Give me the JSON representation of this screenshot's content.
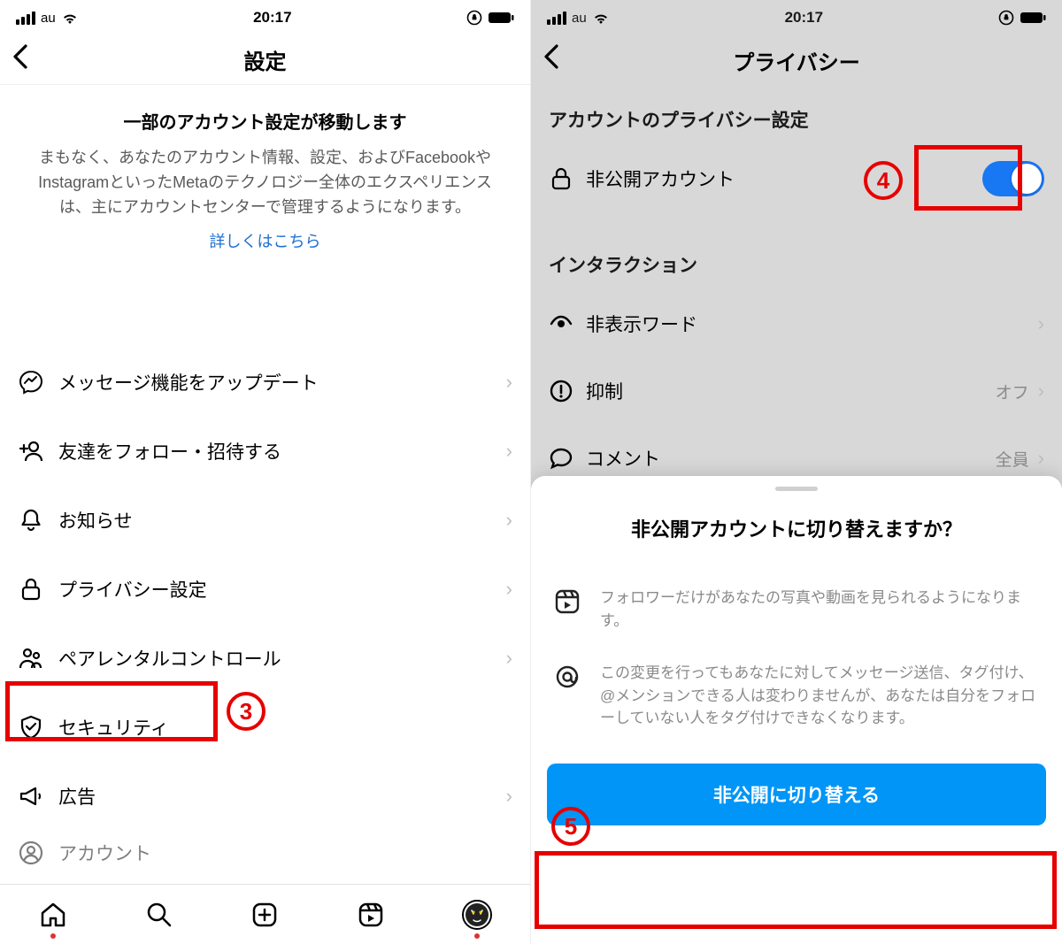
{
  "status": {
    "carrier": "au",
    "time": "20:17"
  },
  "left": {
    "title": "設定",
    "notice": {
      "title": "一部のアカウント設定が移動します",
      "body": "まもなく、あなたのアカウント情報、設定、およびFacebookやInstagramといったMetaのテクノロジー全体のエクスペリエンスは、主にアカウントセンターで管理するようになります。",
      "link": "詳しくはこちら"
    },
    "items": [
      {
        "label": "メッセージ機能をアップデート",
        "icon": "messenger"
      },
      {
        "label": "友達をフォロー・招待する",
        "icon": "follow-invite"
      },
      {
        "label": "お知らせ",
        "icon": "bell"
      },
      {
        "label": "プライバシー設定",
        "icon": "lock"
      },
      {
        "label": "ペアレンタルコントロール",
        "icon": "parental"
      },
      {
        "label": "セキュリティ",
        "icon": "shield"
      },
      {
        "label": "広告",
        "icon": "megaphone"
      },
      {
        "label": "アカウント",
        "icon": "account"
      }
    ]
  },
  "right": {
    "title": "プライバシー",
    "section_privacy": "アカウントのプライバシー設定",
    "private_account": "非公開アカウント",
    "section_interaction": "インタラクション",
    "interaction_items": [
      {
        "label": "非表示ワード",
        "value": ""
      },
      {
        "label": "抑制",
        "value": "オフ"
      },
      {
        "label": "コメント",
        "value": "全員"
      }
    ],
    "sheet": {
      "title": "非公開アカウントに切り替えますか？",
      "row1": "フォロワーだけがあなたの写真や動画を見られるようになります。",
      "row2": "この変更を行ってもあなたに対してメッセージ送信、タグ付け、@メンションできる人は変わりませんが、あなたは自分をフォローしていない人をタグ付けできなくなります。",
      "button": "非公開に切り替える"
    }
  },
  "annotations": {
    "n3": "3",
    "n4": "4",
    "n5": "5"
  }
}
